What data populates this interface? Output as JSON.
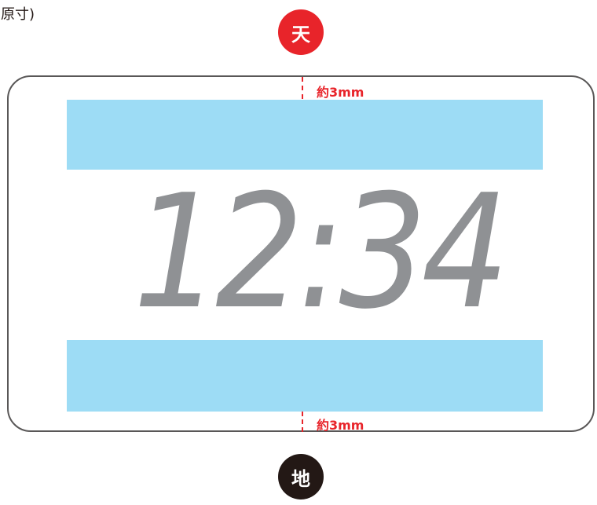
{
  "caption": "(原寸)",
  "badges": {
    "top": "天",
    "bottom": "地"
  },
  "margin_labels": {
    "top": "約3mm",
    "bottom": "約3mm"
  },
  "display": {
    "time": "12:34"
  },
  "colors": {
    "badge_top": "#e8242a",
    "badge_bottom": "#231815",
    "band": "#9ddcf5",
    "dimension": "#e8242a",
    "time_text": "#8f9194",
    "frame_border": "#595757"
  }
}
